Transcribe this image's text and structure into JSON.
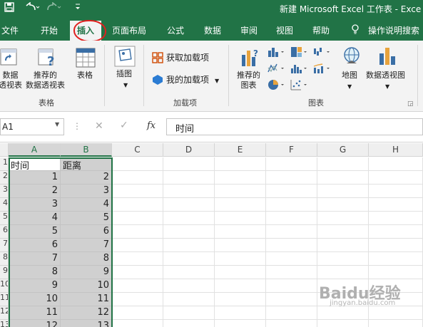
{
  "window": {
    "title": "新建 Microsoft Excel 工作表 - Exce"
  },
  "qat": {
    "save_icon": "save-icon",
    "undo_icon": "undo-icon",
    "redo_icon": "redo-icon",
    "customize_icon": "chevron-down-icon"
  },
  "tabs": [
    {
      "label": "文件"
    },
    {
      "label": "开始"
    },
    {
      "label": "插入"
    },
    {
      "label": "页面布局"
    },
    {
      "label": "公式"
    },
    {
      "label": "数据"
    },
    {
      "label": "审阅"
    },
    {
      "label": "视图"
    },
    {
      "label": "帮助"
    },
    {
      "label": "操作说明搜索"
    }
  ],
  "ribbon": {
    "pivot_line1": "数据",
    "pivot_line2": "透视表",
    "recpivot_line1": "推荐的",
    "recpivot_line2": "数据透视表",
    "table": "表格",
    "group_tables": "表格",
    "illustrations": "插图",
    "get_addins": "获取加载项",
    "my_addins": "我的加载项",
    "group_addins": "加载项",
    "recchart_line1": "推荐的",
    "recchart_line2": "图表",
    "maps": "地图",
    "pivotchart": "数据透视图",
    "group_charts": "图表"
  },
  "formula_bar": {
    "name_box": "A1",
    "fx": "fx",
    "content": "时间"
  },
  "columns": [
    "A",
    "B",
    "C",
    "D",
    "E",
    "F",
    "G",
    "H"
  ],
  "row_numbers": [
    "1",
    "2",
    "3",
    "4",
    "5",
    "6",
    "7",
    "8",
    "9",
    "10",
    "11",
    "12",
    "13"
  ],
  "rows": [
    [
      "时间",
      "距离"
    ],
    [
      "1",
      "2"
    ],
    [
      "2",
      "3"
    ],
    [
      "3",
      "4"
    ],
    [
      "4",
      "5"
    ],
    [
      "5",
      "6"
    ],
    [
      "6",
      "7"
    ],
    [
      "7",
      "8"
    ],
    [
      "8",
      "9"
    ],
    [
      "9",
      "10"
    ],
    [
      "10",
      "11"
    ],
    [
      "11",
      "12"
    ],
    [
      "12",
      "13"
    ]
  ],
  "watermark": {
    "text": "Baidu经验",
    "url": "jingyan.baidu.com"
  },
  "colors": {
    "excel_green": "#217346",
    "annotation_red": "#e0201e",
    "selection_gray": "#d0d0d0"
  }
}
